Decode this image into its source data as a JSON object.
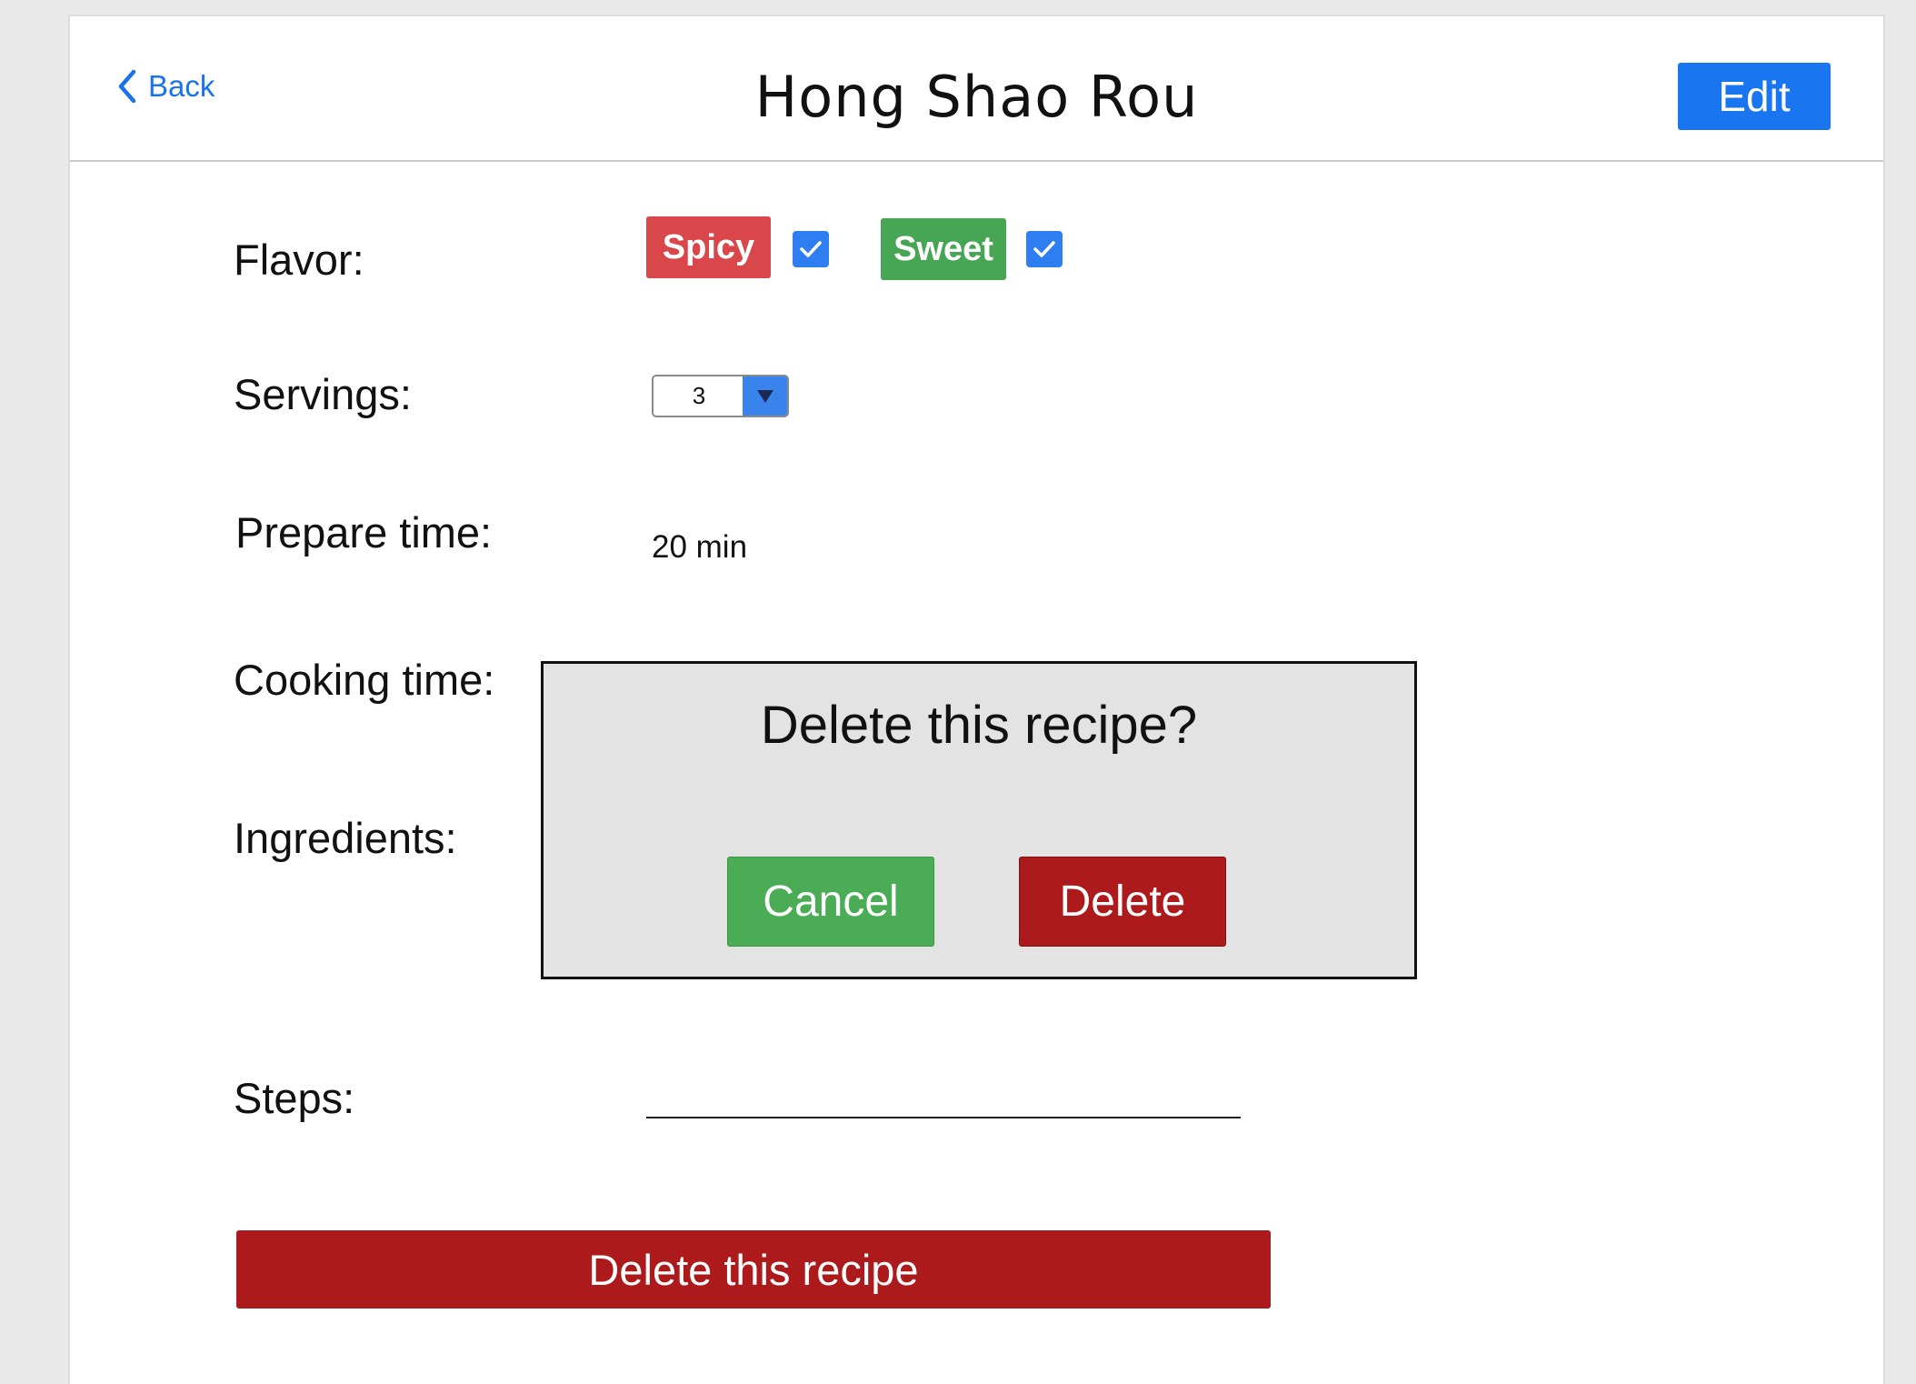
{
  "header": {
    "back_label": "Back",
    "title": "Hong Shao Rou",
    "edit_label": "Edit"
  },
  "form": {
    "flavor_label": "Flavor:",
    "flavors": [
      {
        "label": "Spicy",
        "checked": true,
        "color": "#d9474a"
      },
      {
        "label": "Sweet",
        "checked": true,
        "color": "#47a653"
      }
    ],
    "servings_label": "Servings:",
    "servings_value": "3",
    "prepare_time_label": "Prepare time:",
    "prepare_time_value": "20 min",
    "cooking_time_label": "Cooking time:",
    "ingredients_label": "Ingredients:",
    "steps_label": "Steps:",
    "delete_recipe_label": "Delete this recipe"
  },
  "dialog": {
    "title": "Delete this recipe?",
    "cancel_label": "Cancel",
    "delete_label": "Delete"
  },
  "colors": {
    "accent_blue": "#1976f0",
    "danger_red": "#ad1a1c",
    "success_green": "#4bac56"
  },
  "icons": {
    "back": "chevron-left-icon",
    "checkbox": "checkmark-icon",
    "dropdown": "triangle-down-icon"
  }
}
